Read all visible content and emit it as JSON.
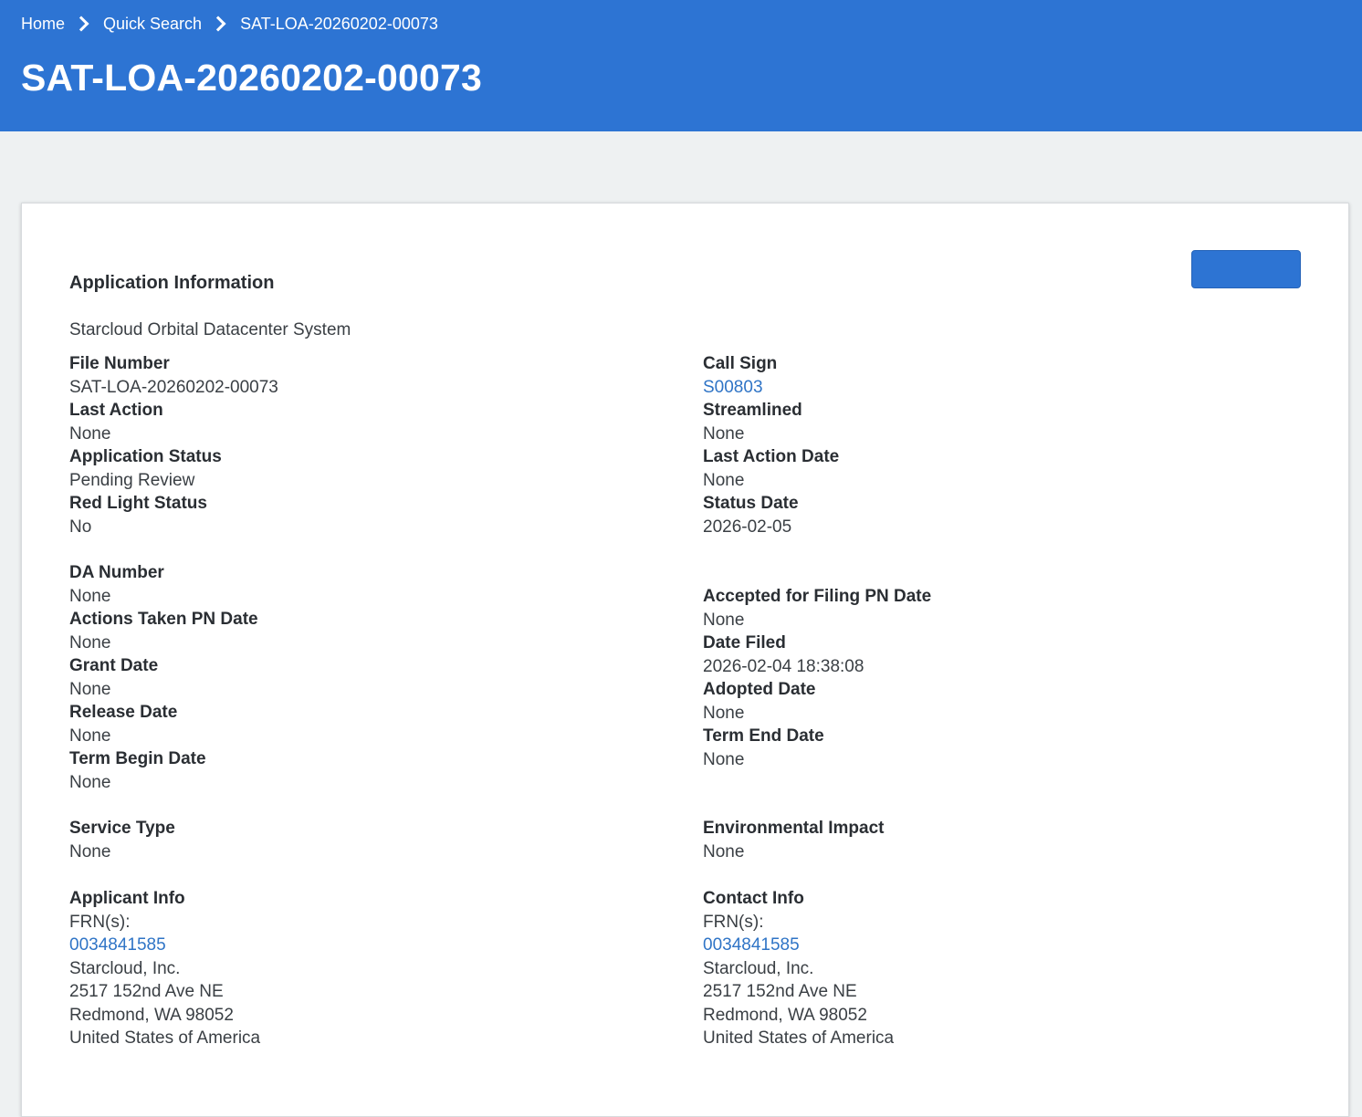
{
  "breadcrumb": {
    "home": "Home",
    "quick_search": "Quick Search",
    "current": "SAT-LOA-20260202-00073"
  },
  "page_title": "SAT-LOA-20260202-00073",
  "section": {
    "title": "Application Information",
    "subtitle": "Starcloud Orbital Datacenter System"
  },
  "fields": {
    "file_number": {
      "label": "File Number",
      "value": "SAT-LOA-20260202-00073"
    },
    "call_sign": {
      "label": "Call Sign",
      "value": "S00803"
    },
    "last_action": {
      "label": "Last Action",
      "value": "None"
    },
    "streamlined": {
      "label": "Streamlined",
      "value": "None"
    },
    "application_status": {
      "label": "Application Status",
      "value": "Pending Review"
    },
    "last_action_date": {
      "label": "Last Action Date",
      "value": "None"
    },
    "red_light_status": {
      "label": "Red Light Status",
      "value": "No"
    },
    "status_date": {
      "label": "Status Date",
      "value": "2026-02-05"
    },
    "da_number": {
      "label": "DA Number",
      "value": "None"
    },
    "accepted_pn_date": {
      "label": "Accepted for Filing PN Date",
      "value": "None"
    },
    "actions_taken_pn_date": {
      "label": "Actions Taken PN Date",
      "value": "None"
    },
    "date_filed": {
      "label": "Date Filed",
      "value": "2026-02-04 18:38:08"
    },
    "grant_date": {
      "label": "Grant Date",
      "value": "None"
    },
    "adopted_date": {
      "label": "Adopted Date",
      "value": "None"
    },
    "release_date": {
      "label": "Release Date",
      "value": "None"
    },
    "term_end_date": {
      "label": "Term End Date",
      "value": "None"
    },
    "term_begin_date": {
      "label": "Term Begin Date",
      "value": "None"
    },
    "service_type": {
      "label": "Service Type",
      "value": "None"
    },
    "environmental_impact": {
      "label": "Environmental Impact",
      "value": "None"
    }
  },
  "applicant": {
    "label": "Applicant Info",
    "frn_label": "FRN(s):",
    "frn": "0034841585",
    "name": "Starcloud, Inc.",
    "address1": "2517 152nd Ave NE",
    "address2": "Redmond, WA 98052",
    "country": "United States of America"
  },
  "contact": {
    "label": "Contact Info",
    "frn_label": "FRN(s):",
    "frn": "0034841585",
    "name": "Starcloud, Inc.",
    "address1": "2517 152nd Ave NE",
    "address2": "Redmond, WA 98052",
    "country": "United States of America"
  },
  "colors": {
    "header": "#2d74d3",
    "link": "#2f74c6",
    "background": "#eef1f2"
  }
}
